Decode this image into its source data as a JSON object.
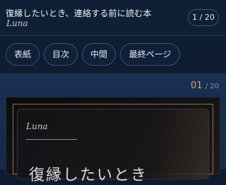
{
  "header": {
    "title": "復縁したいとき、連絡する前に読む本",
    "author": "Luna",
    "page_counter": "1 / 20"
  },
  "nav": {
    "cover": "表紙",
    "toc": "目次",
    "middle": "中間",
    "last_page": "最終ページ"
  },
  "page": {
    "current": "01",
    "total": "/ 20"
  },
  "card": {
    "author": "Luna",
    "title": "復縁したいとき"
  },
  "colors": {
    "background": "#0d1b2e",
    "accent_gold": "#c9a860"
  }
}
